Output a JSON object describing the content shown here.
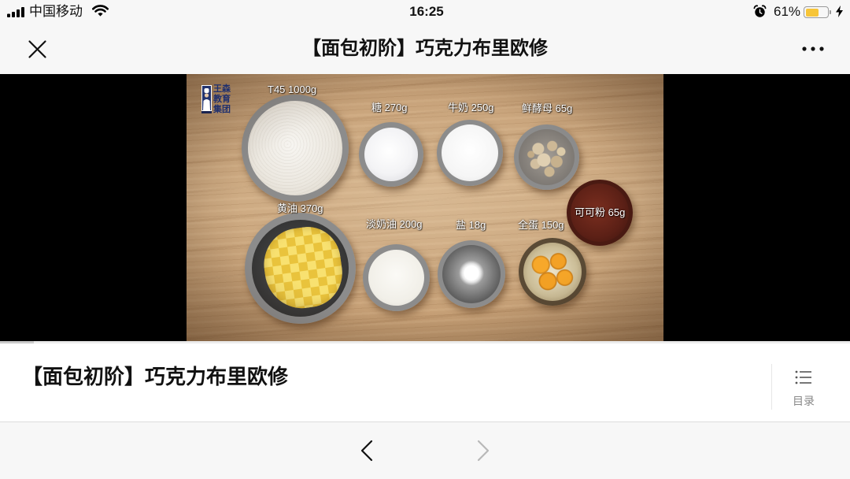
{
  "status_bar": {
    "carrier": "中国移动",
    "time": "16:25",
    "battery_text": "61%",
    "battery_level": 0.61,
    "icons": {
      "signal": "signal-bars-icon",
      "wifi": "wifi-icon",
      "alarm": "alarm-clock-icon",
      "battery": "battery-icon",
      "charging": "charging-bolt-icon"
    }
  },
  "nav_bar": {
    "title": "【面包初阶】巧克力布里欧修",
    "icons": {
      "close": "close-icon",
      "more": "more-dots-icon"
    }
  },
  "video": {
    "logo_lines": [
      "王森",
      "教育",
      "集团"
    ],
    "ingredients": [
      "T45 1000g",
      "糖 270g",
      "牛奶 250g",
      "鲜酵母 65g",
      "可可粉 65g",
      "黄油 370g",
      "淡奶油 200g",
      "盐 18g",
      "全蛋 150g"
    ],
    "progress": 0.04
  },
  "article": {
    "title": "【面包初阶】巧克力布里欧修",
    "toc_label": "目录",
    "toc_icon": "list-icon"
  },
  "toolbar": {
    "back_icon": "chevron-left-icon",
    "forward_icon": "chevron-right-icon",
    "forward_enabled": false
  },
  "colors": {
    "bar_background": "#f7f7f7",
    "text_primary": "#111111",
    "text_secondary": "#888888",
    "battery_fill": "#f7c538",
    "video_background": "#000000",
    "disabled_icon": "#b8b8b8"
  }
}
